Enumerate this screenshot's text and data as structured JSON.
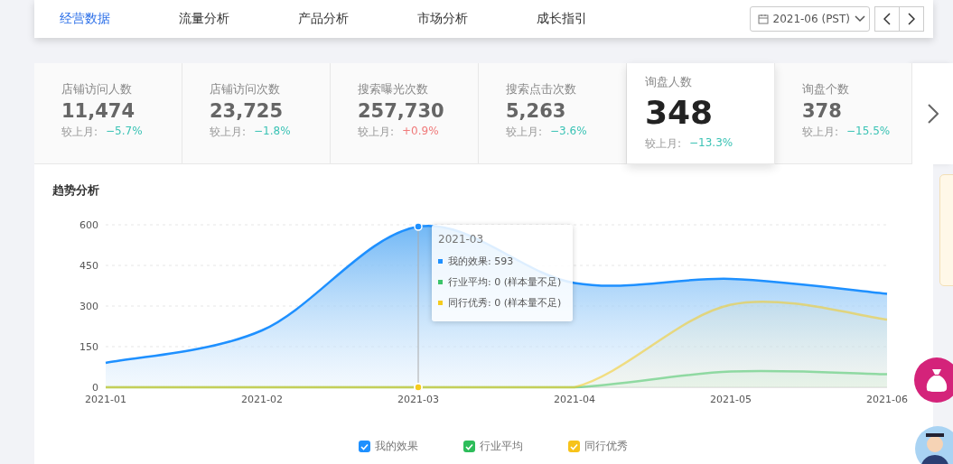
{
  "nav": {
    "tabs": [
      {
        "label": "经营数据",
        "selected": true
      },
      {
        "label": "流量分析",
        "selected": false
      },
      {
        "label": "产品分析",
        "selected": false
      },
      {
        "label": "市场分析",
        "selected": false
      },
      {
        "label": "成长指引",
        "selected": false
      }
    ],
    "date": "2021-06 (PST)"
  },
  "metrics": [
    {
      "label": "店铺访问人数",
      "value": "11,474",
      "compare": "较上月:",
      "change": "−5.7%",
      "color": "#3bc3b5",
      "selected": false
    },
    {
      "label": "店铺访问次数",
      "value": "23,725",
      "compare": "较上月:",
      "change": "−1.8%",
      "color": "#3bc3b5",
      "selected": false
    },
    {
      "label": "搜索曝光次数",
      "value": "257,730",
      "compare": "较上月:",
      "change": "+0.9%",
      "color": "#f07a7a",
      "selected": false
    },
    {
      "label": "搜索点击次数",
      "value": "5,263",
      "compare": "较上月:",
      "change": "−3.6%",
      "color": "#3bc3b5",
      "selected": false
    },
    {
      "label": "询盘人数",
      "value": "348",
      "compare": "较上月:",
      "change": "−13.3%",
      "color": "#3bc3b5",
      "selected": true
    },
    {
      "label": "询盘个数",
      "value": "378",
      "compare": "较上月:",
      "change": "−15.5%",
      "color": "#3bc3b5",
      "selected": false
    }
  ],
  "trend": {
    "title": "趋势分析",
    "chart_data": {
      "type": "area",
      "grid": true,
      "ref_lines": [
        {
          "axis": "x",
          "value": "2021-03"
        }
      ],
      "categories": [
        "2021-01",
        "2021-02",
        "2021-03",
        "2021-04",
        "2021-05",
        "2021-06"
      ],
      "ylim": [
        0,
        600
      ],
      "yticks": [
        0,
        150,
        300,
        450,
        600
      ],
      "series": [
        {
          "name": "我的效果",
          "color": "#1e90ff",
          "values": [
            90,
            210,
            593,
            385,
            400,
            345
          ]
        },
        {
          "name": "行业平均",
          "color": "#3cc46a",
          "values": [
            0,
            0,
            0,
            0,
            58,
            48
          ]
        },
        {
          "name": "同行优秀",
          "color": "#f5cb1e",
          "values": [
            0,
            0,
            0,
            0,
            305,
            250
          ]
        }
      ]
    },
    "tooltip": {
      "title": "2021-03",
      "rows": [
        {
          "text": "我的效果: 593",
          "color": "#1e90ff"
        },
        {
          "text": "行业平均: 0 (样本量不足)",
          "color": "#3cc46a"
        },
        {
          "text": "同行优秀: 0 (样本量不足)",
          "color": "#f5cb1e"
        }
      ]
    },
    "legend": [
      {
        "checked": true,
        "color": "#1e90ff"
      },
      {
        "checked": true,
        "color": "#2dbd5a"
      },
      {
        "checked": true,
        "color": "#f7c31a"
      }
    ]
  }
}
